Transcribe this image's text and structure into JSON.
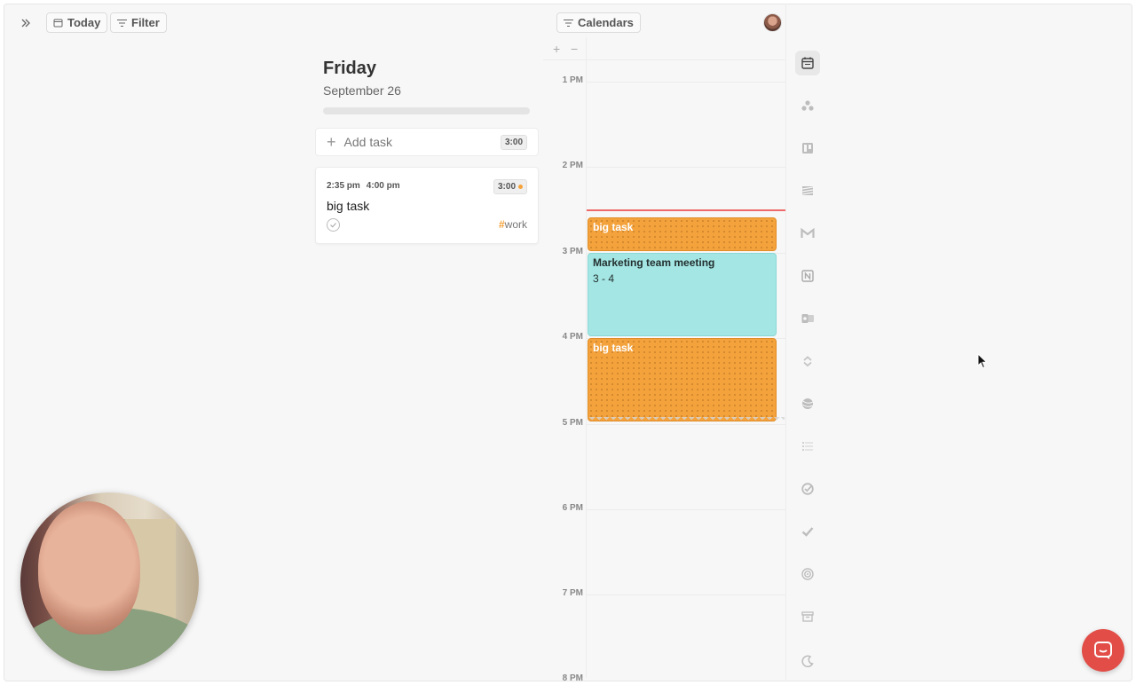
{
  "toolbar": {
    "today_label": "Today",
    "filter_label": "Filter",
    "calendars_label": "Calendars"
  },
  "day": {
    "title": "Friday",
    "date": "September 26",
    "progress": 0
  },
  "add_task": {
    "label": "Add task",
    "duration": "3:00"
  },
  "task": {
    "start": "2:35 pm",
    "end": "4:00 pm",
    "duration": "3:00",
    "title": "big task",
    "tag": "work"
  },
  "calendar": {
    "zoom_in": "+",
    "zoom_out": "−",
    "hours": [
      "1 PM",
      "2 PM",
      "3 PM",
      "4 PM",
      "5 PM",
      "6 PM",
      "7 PM",
      "8 PM"
    ],
    "events": [
      {
        "title": "big task",
        "type": "task"
      },
      {
        "title": "Marketing team meeting",
        "time": "3 - 4",
        "type": "meeting"
      },
      {
        "title": "big task",
        "type": "task"
      }
    ]
  },
  "rail": {
    "icons": [
      "calendar-icon",
      "team-icon",
      "board-icon",
      "stripes-icon",
      "gmail-icon",
      "notion-icon",
      "outlook-icon",
      "sync-icon",
      "sphere-icon",
      "list-icon",
      "target-check-icon",
      "checkmark-icon",
      "radio-icon",
      "archive-icon",
      "moon-icon"
    ]
  },
  "colors": {
    "task": "#f4a23c",
    "meeting": "#a4e6e4",
    "now_line": "#ee6a6a",
    "chat": "#e24d47"
  }
}
